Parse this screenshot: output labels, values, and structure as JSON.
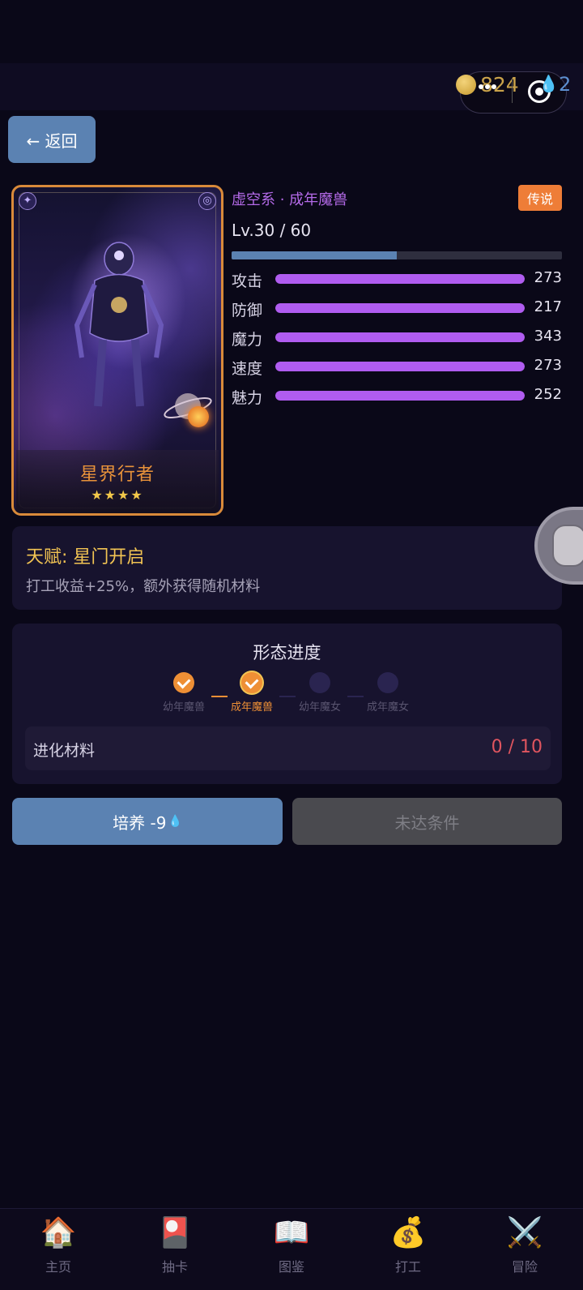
{
  "header": {
    "coins": "824",
    "gems": "2"
  },
  "nav": {
    "back_label": "← 返回"
  },
  "card": {
    "name": "星界行者",
    "stars": "★★★★"
  },
  "info": {
    "type_label": "虚空系 · 成年魔兽",
    "rarity": "传说",
    "level_text": "Lv.30 / 60",
    "level_progress": 0.5,
    "stats": [
      {
        "label": "攻击",
        "value": "273",
        "fill": 1.0
      },
      {
        "label": "防御",
        "value": "217",
        "fill": 1.0
      },
      {
        "label": "魔力",
        "value": "343",
        "fill": 1.0
      },
      {
        "label": "速度",
        "value": "273",
        "fill": 1.0
      },
      {
        "label": "魅力",
        "value": "252",
        "fill": 1.0
      }
    ]
  },
  "talent": {
    "title": "天赋: 星门开启",
    "description": "打工收益+25%，额外获得随机材料"
  },
  "form": {
    "title": "形态进度",
    "stages": [
      {
        "label": "幼年魔兽",
        "state": "done"
      },
      {
        "label": "成年魔兽",
        "state": "current"
      },
      {
        "label": "幼年魔女",
        "state": "locked"
      },
      {
        "label": "成年魔女",
        "state": "locked"
      }
    ],
    "material_label": "进化材料",
    "material_count": "0 / 10"
  },
  "actions": {
    "cultivate_label": "培养 -9",
    "cultivate_icon": "💧",
    "evolve_label": "未达条件"
  },
  "bottom_nav": [
    {
      "icon": "🏠",
      "label": "主页"
    },
    {
      "icon": "🎴",
      "label": "抽卡"
    },
    {
      "icon": "📖",
      "label": "图鉴"
    },
    {
      "icon": "💰",
      "label": "打工"
    },
    {
      "icon": "⚔️",
      "label": "冒险"
    }
  ]
}
